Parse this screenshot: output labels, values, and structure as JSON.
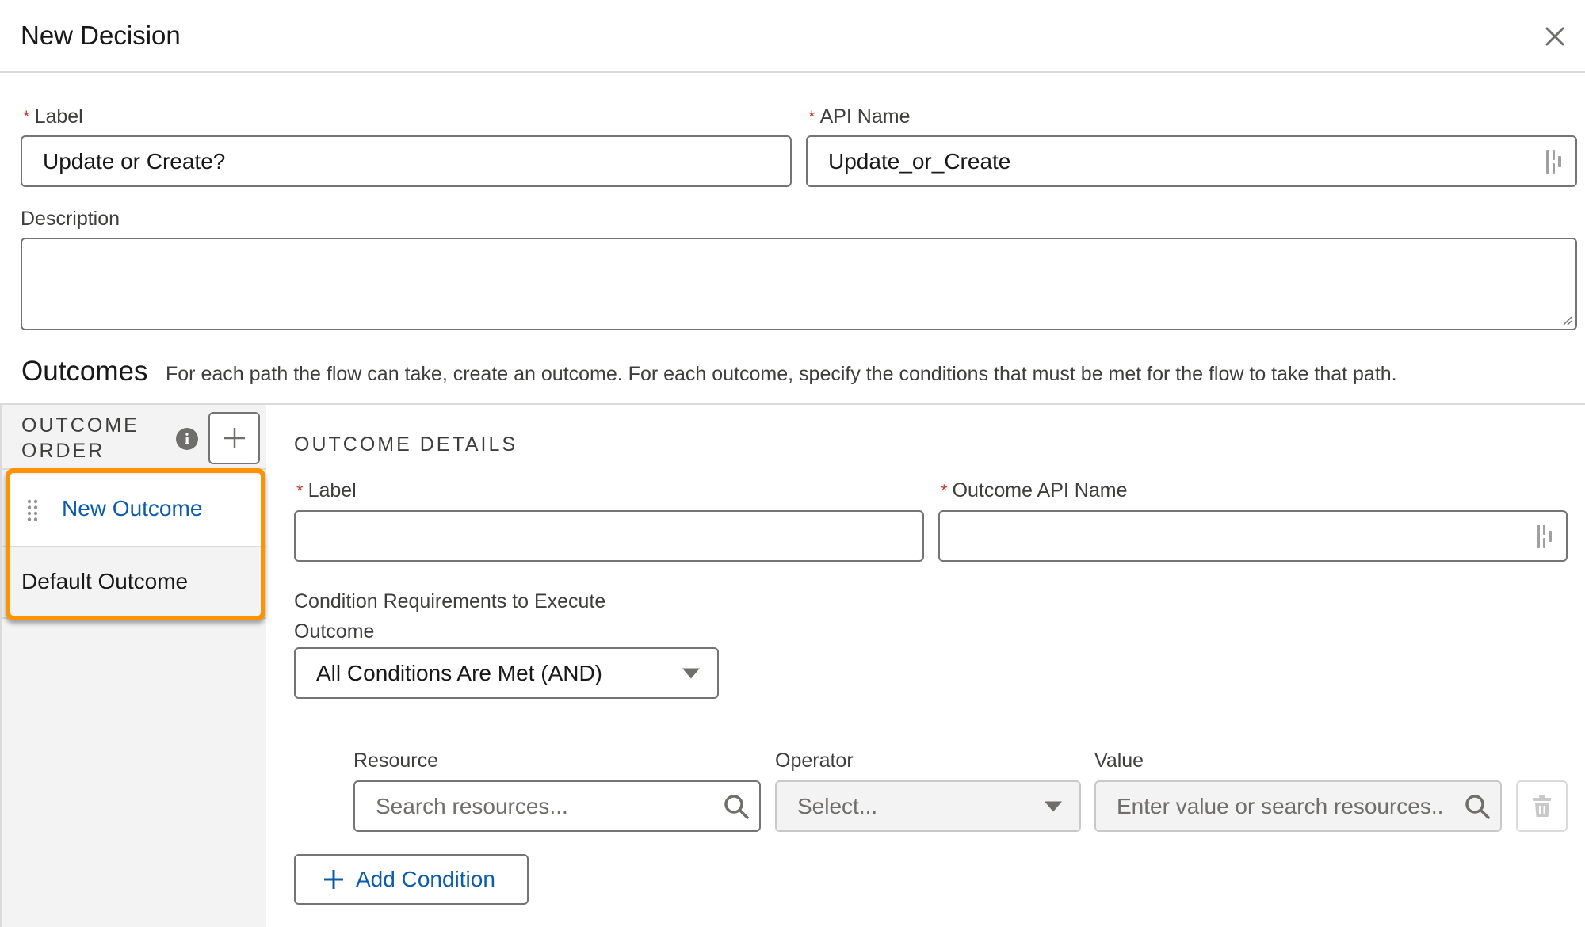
{
  "modal": {
    "title": "New Decision",
    "close_icon": "close-icon"
  },
  "form": {
    "label": {
      "label": "Label",
      "required": "*",
      "value": "Update or Create?"
    },
    "api_name": {
      "label": "API Name",
      "required": "*",
      "value": "Update_or_Create",
      "icon": "merge-field-icon"
    },
    "description": {
      "label": "Description",
      "value": ""
    }
  },
  "outcomes": {
    "title": "Outcomes",
    "description": "For each path the flow can take, create an outcome. For each outcome, specify the conditions that must be met for the flow to take that path.",
    "sidebar": {
      "header_line1": "OUTCOME",
      "header_line2": "ORDER",
      "info_glyph": "i",
      "add_icon": "plus-icon",
      "items": [
        {
          "label": "New Outcome",
          "selected": true,
          "draggable": true
        },
        {
          "label": "Default Outcome",
          "selected": false,
          "draggable": false
        }
      ],
      "highlight_color": "#fe9300"
    },
    "details": {
      "heading": "OUTCOME DETAILS",
      "label_field": {
        "label": "Label",
        "required": "*",
        "value": ""
      },
      "api_name_field": {
        "label": "Outcome API Name",
        "required": "*",
        "value": ""
      },
      "condition_requirements": {
        "label": "Condition Requirements to Execute Outcome",
        "label_line1": "Condition Requirements to Execute",
        "label_line2": "Outcome",
        "selected": "All Conditions Are Met (AND)"
      },
      "condition_row": {
        "resource": {
          "label": "Resource",
          "placeholder": "Search resources..."
        },
        "operator": {
          "label": "Operator",
          "placeholder": "Select...",
          "disabled": true
        },
        "value": {
          "label": "Value",
          "placeholder": "Enter value or search resources..",
          "disabled": true
        },
        "delete_icon": "trash-icon"
      },
      "add_condition_label": "Add Condition"
    }
  },
  "colors": {
    "link_blue": "#0b5cab",
    "required_red": "#c23934",
    "highlight_orange": "#fe9300"
  }
}
